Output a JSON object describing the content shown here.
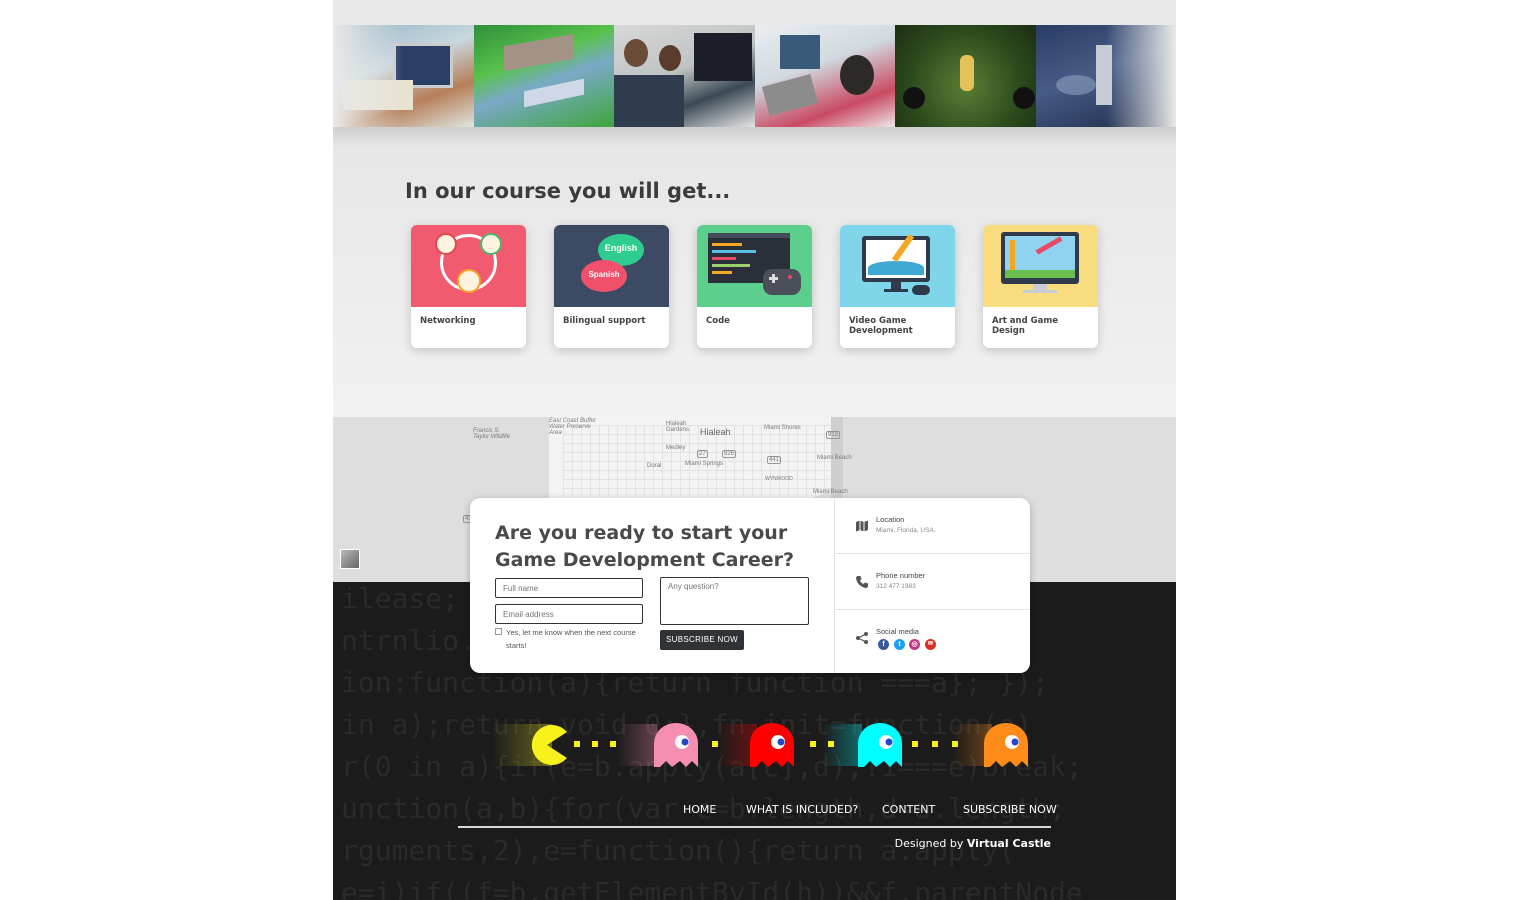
{
  "features": {
    "title": "In our course you will get...",
    "cards": [
      {
        "label": "Networking",
        "icon": "networking-icon",
        "color": "#f25a6f"
      },
      {
        "label": "Bilingual support",
        "icon": "speech-bubbles-icon",
        "color": "#3d4a63",
        "bubble_top": "English",
        "bubble_bottom": "Spanish"
      },
      {
        "label": "Code",
        "icon": "code-editor-icon",
        "color": "#5dcf8d"
      },
      {
        "label": "Video Game Development",
        "icon": "monitor-gamepad-icon",
        "color": "#7fd6ea"
      },
      {
        "label": "Art and Game Design",
        "icon": "design-monitor-icon",
        "color": "#f7dc80"
      }
    ]
  },
  "map": {
    "labels": [
      "Francis S. Taylor Wildlife",
      "East Coast Buffer Water Preserve Area",
      "Hialeah Gardens",
      "Hialeah",
      "Miami Shores",
      "Medley",
      "Doral",
      "Miami Springs",
      "Miami Beach",
      "WYNWOOD",
      "Miami Beach"
    ],
    "shields": [
      "27",
      "826",
      "441",
      "913",
      "41"
    ]
  },
  "form": {
    "title": "Are you ready to start your Game Development Career?",
    "name_placeholder": "Full name",
    "email_placeholder": "Email address",
    "question_placeholder": "Any question?",
    "checkbox_label": "Yes, let me know when the next course starts!",
    "subscribe_label": "SUBSCRIBE NOW"
  },
  "contact": {
    "location_label": "Location",
    "location_value": "Miami, Florida, USA.",
    "phone_label": "Phone number",
    "phone_value": "312 477 1983",
    "social_label": "Social media",
    "social": [
      {
        "icon": "facebook-icon",
        "glyph": "f",
        "color": "#3b5998"
      },
      {
        "icon": "twitter-icon",
        "glyph": "t",
        "color": "#1da1f2"
      },
      {
        "icon": "instagram-icon",
        "glyph": "◎",
        "color": "#c13584"
      },
      {
        "icon": "email-icon",
        "glyph": "✉",
        "color": "#d93025"
      }
    ]
  },
  "nav": {
    "home": "HOME",
    "included": "WHAT IS INCLUDED?",
    "content": "CONTENT",
    "subscribe": "SUBSCRIBE NOW"
  },
  "footer": {
    "credit_prefix": "Designed by ",
    "credit_name": "Virtual Castle"
  },
  "colors": {
    "pacman": "#f7f21c",
    "ghost_pink": "#f48fb1",
    "ghost_red": "#ff0000",
    "ghost_cyan": "#00ffff",
    "ghost_orange": "#ff8c1a"
  }
}
